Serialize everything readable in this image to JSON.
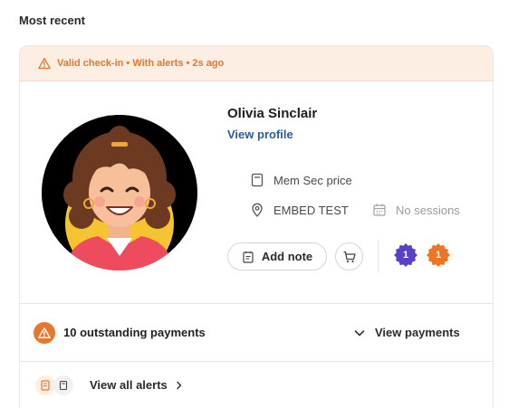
{
  "section": {
    "title": "Most recent"
  },
  "checkin": {
    "status_text": "Valid check-in • With alerts • 2s ago",
    "accent_color": "#e8762b",
    "banner_color": "#fdeee4"
  },
  "member": {
    "name": "Olivia Sinclair",
    "view_profile_label": "View profile",
    "membership": "Mem Sec price",
    "location": "EMBED TEST",
    "sessions": "No sessions"
  },
  "actions": {
    "add_note_label": "Add note",
    "cart_icon": "cart-icon"
  },
  "badges": [
    {
      "count": "1",
      "color": "#5b3fc4"
    },
    {
      "count": "1",
      "color": "#ef7424"
    }
  ],
  "payments": {
    "summary": "10 outstanding payments",
    "view_label": "View payments"
  },
  "alerts": {
    "view_all_label": "View all alerts"
  }
}
